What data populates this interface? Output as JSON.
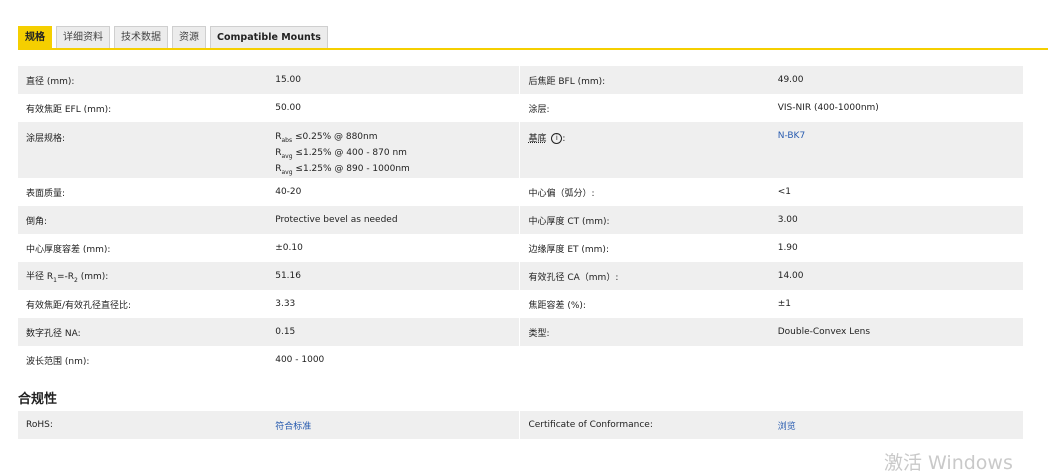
{
  "tabs": [
    "规格",
    "详细资料",
    "技术数据",
    "资源",
    "Compatible Mounts"
  ],
  "specs": {
    "diameter": {
      "label": "直径 (mm):",
      "value": "15.00"
    },
    "bfl": {
      "label": "后焦距 BFL (mm):",
      "value": "49.00"
    },
    "efl": {
      "label": "有效焦距 EFL (mm):",
      "value": "50.00"
    },
    "coating": {
      "label": "涂层:",
      "value": "VIS-NIR (400-1000nm)"
    },
    "coating_spec": {
      "label": "涂层规格:",
      "lines": [
        {
          "sym": "R",
          "sub": "abs",
          "text": "≤0.25% @ 880nm"
        },
        {
          "sym": "R",
          "sub": "avg",
          "text": "≤1.25% @ 400 - 870 nm"
        },
        {
          "sym": "R",
          "sub": "avg",
          "text": "≤1.25% @ 890 - 1000nm"
        }
      ]
    },
    "substrate": {
      "label": "基底",
      "info": "i",
      "value": "N-BK7"
    },
    "surface_quality": {
      "label": "表面质量:",
      "value": "40-20"
    },
    "centering": {
      "label": "中心偏（弧分）:",
      "value": "<1"
    },
    "bevel": {
      "label": "倒角:",
      "value": "Protective bevel as needed"
    },
    "ct": {
      "label": "中心厚度 CT (mm):",
      "value": "3.00"
    },
    "ct_tol": {
      "label": "中心厚度容差 (mm):",
      "value": "±0.10"
    },
    "et": {
      "label": "边缘厚度 ET (mm):",
      "value": "1.90"
    },
    "radius": {
      "label_pre": "半径 R",
      "sub1": "1",
      "label_mid": "=-R",
      "sub2": "2",
      "label_post": " (mm):",
      "value": "51.16"
    },
    "ca": {
      "label": "有效孔径 CA（mm）:",
      "value": "14.00"
    },
    "f_number": {
      "label": "有效焦距/有效孔径直径比:",
      "value": "3.33"
    },
    "fl_tol": {
      "label": "焦距容差 (%):",
      "value": "±1"
    },
    "na": {
      "label": "数字孔径 NA:",
      "value": "0.15"
    },
    "type": {
      "label": "类型:",
      "value": "Double-Convex Lens"
    },
    "wavelength": {
      "label": "波长范围 (nm):",
      "value": "400 - 1000"
    }
  },
  "compliance": {
    "title": "合规性",
    "rohs_label": "RoHS:",
    "rohs_value": "符合标准",
    "coc_label": "Certificate of Conformance:",
    "coc_value": "浏览"
  },
  "watermark": "激活 Windows"
}
